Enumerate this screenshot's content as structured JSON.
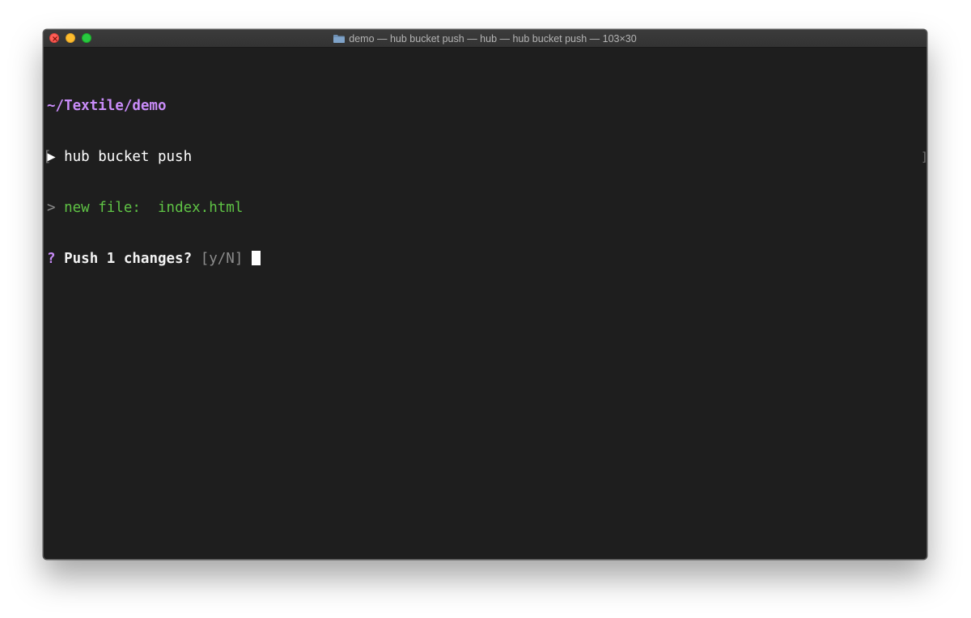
{
  "window": {
    "title": "demo — hub bucket push — hub — hub bucket push — 103×30",
    "folder_icon": "folder-icon",
    "colors": {
      "background": "#1e1e1e",
      "close": "#fe5f57",
      "minimize": "#febc2e",
      "zoom": "#28c840"
    }
  },
  "terminal": {
    "cwd": "~/Textile/demo",
    "prompt_marker": "▶",
    "command": "hub bucket push",
    "change_marker": ">",
    "change_label": "new file:",
    "change_file": "index.html",
    "question_mark": "?",
    "question": "Push 1 changes?",
    "options": "[y/N]",
    "colors": {
      "cwd": "#c98cf9",
      "change": "#5fc345",
      "options": "#8c8c8c",
      "text": "#ffffff"
    }
  }
}
